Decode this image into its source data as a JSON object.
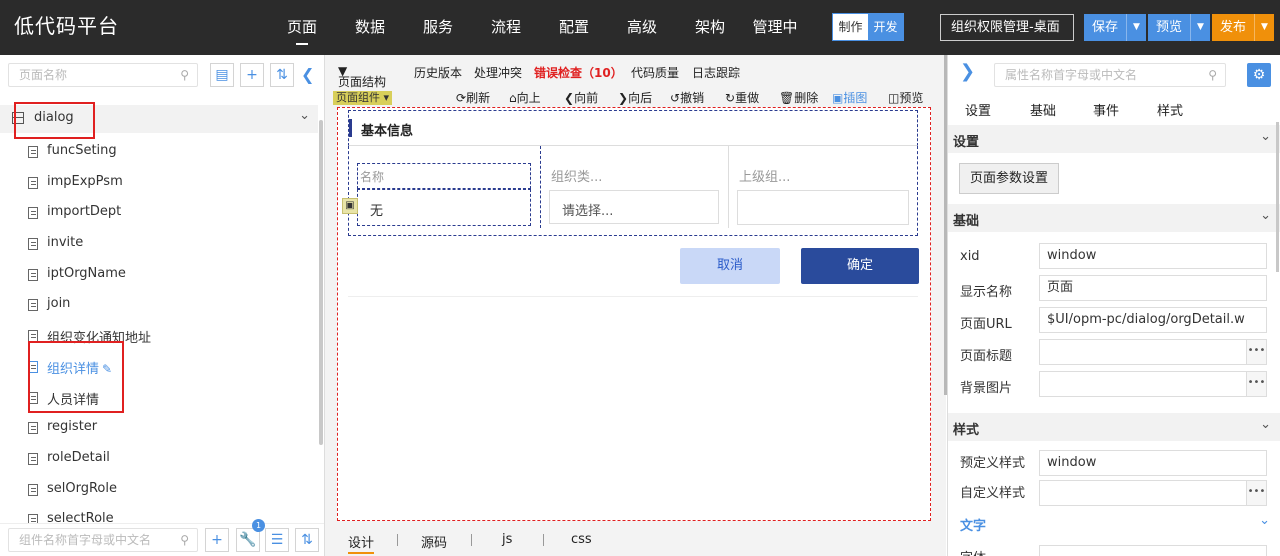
{
  "app": {
    "logo": "低代码平台",
    "nav": [
      "页面",
      "数据",
      "服务",
      "流程",
      "配置",
      "高级",
      "架构",
      "管理中"
    ],
    "mode_make": "制作",
    "mode_dev": "开发",
    "page_select": "组织权限管理-桌面",
    "save": "保存",
    "preview": "预览",
    "publish": "发布",
    "caret": "▼"
  },
  "left": {
    "search_placeholder": "页面名称",
    "root_label": "dialog",
    "items": [
      "funcSeting",
      "impExpPsm",
      "importDept",
      "invite",
      "iptOrgName",
      "join",
      "组织变化通知地址",
      "组织详情",
      "人员详情",
      "register",
      "roleDetail",
      "selOrgRole",
      "selectRole"
    ],
    "active_index": 7,
    "bottom_search_placeholder": "组件名称首字母或中文名",
    "badge": "1"
  },
  "center": {
    "toolbar": {
      "structure": "页面结构",
      "history": "历史版本",
      "conflict": "处理冲突",
      "error_check": "错误检查（10）",
      "quality": "代码质量",
      "log": "日志跟踪"
    },
    "component_tag": "页面组件",
    "actions": {
      "refresh": "刷新",
      "up": "向上",
      "forward": "向前",
      "backward": "向后",
      "undo": "撤销",
      "redo": "重做",
      "delete": "删除",
      "insert": "插图",
      "preview": "预览"
    },
    "form": {
      "section_title": "基本信息",
      "name_label": "名称",
      "name_value": "无",
      "org_type_label": "组织类...",
      "org_type_placeholder": "请选择...",
      "parent_label": "上级组..."
    },
    "cancel": "取消",
    "ok": "确定",
    "bottom_tabs": [
      "设计",
      "源码",
      "js",
      "css"
    ]
  },
  "right": {
    "search_placeholder": "属性名称首字母或中文名",
    "tabs": [
      "设置",
      "基础",
      "事件",
      "样式"
    ],
    "sections": {
      "settings": "设置",
      "basic": "基础",
      "style": "样式",
      "text": "文字"
    },
    "param_button": "页面参数设置",
    "props": {
      "xid_label": "xid",
      "xid_value": "window",
      "display_name_label": "显示名称",
      "display_name_value": "页面",
      "url_label": "页面URL",
      "url_value": "$UI/opm-pc/dialog/orgDetail.w",
      "title_label": "页面标题",
      "title_value": "",
      "bg_label": "背景图片",
      "bg_value": "",
      "preset_style_label": "预定义样式",
      "preset_style_value": "window",
      "custom_style_label": "自定义样式",
      "custom_style_value": "",
      "font_label": "字体"
    },
    "more": "•••"
  },
  "colors": {
    "topbar": "#2b2b2b",
    "accent": "#4a90e2",
    "publish": "#f0900a",
    "error": "#e02020",
    "confirm": "#2a4b9c"
  }
}
